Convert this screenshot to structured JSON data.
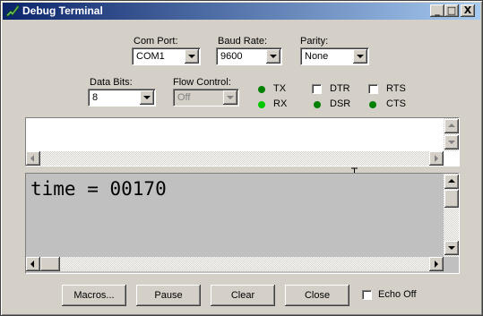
{
  "window": {
    "title": "Debug Terminal",
    "minimize": "_",
    "maximize": "□",
    "close": "X"
  },
  "settings": {
    "com_port": {
      "label": "Com Port:",
      "value": "COM1"
    },
    "baud_rate": {
      "label": "Baud Rate:",
      "value": "9600"
    },
    "parity": {
      "label": "Parity:",
      "value": "None"
    },
    "data_bits": {
      "label": "Data Bits:",
      "value": "8"
    },
    "flow_control": {
      "label": "Flow Control:",
      "value": "Off"
    }
  },
  "indicators": {
    "tx": {
      "label": "TX",
      "color": "#008000"
    },
    "rx": {
      "label": "RX",
      "color": "#00c800"
    },
    "dsr": {
      "label": "DSR",
      "color": "#008000"
    },
    "cts": {
      "label": "CTS",
      "color": "#008000"
    }
  },
  "toggles": {
    "dtr": {
      "label": "DTR",
      "checked": false
    },
    "rts": {
      "label": "RTS",
      "checked": false
    }
  },
  "receive_pane": {
    "text": "time = 00170"
  },
  "buttons": {
    "macros": "Macros...",
    "pause": "Pause",
    "clear": "Clear",
    "close": "Close"
  },
  "echo_off": {
    "label": "Echo Off",
    "checked": false
  }
}
